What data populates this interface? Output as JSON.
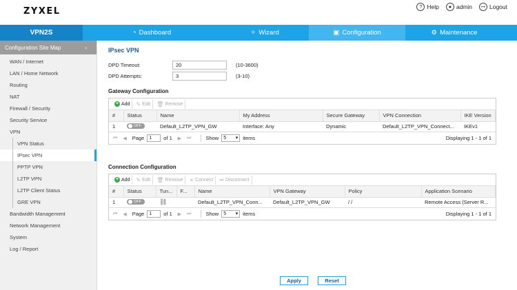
{
  "header": {
    "logo": "ZYXEL",
    "help_label": "Help",
    "user_label": "admin",
    "logout_label": "Logout"
  },
  "nav": {
    "brand": "VPN2S",
    "tabs": [
      {
        "label": "Dashboard",
        "icon": "dashboard-icon"
      },
      {
        "label": "Wizard",
        "icon": "wizard-icon"
      },
      {
        "label": "Configuration",
        "icon": "configuration-icon"
      },
      {
        "label": "Maintenance",
        "icon": "gear-icon"
      }
    ]
  },
  "sidebar": {
    "site_map": "Configuration Site Map",
    "items": [
      "WAN / Internet",
      "LAN / Home Network",
      "Routing",
      "NAT",
      "Firewall / Security",
      "Security Service",
      "VPN",
      "VPN Status",
      "IPsec VPN",
      "PPTP VPN",
      "L2TP VPN",
      "L2TP Client Status",
      "GRE VPN",
      "Bandwidth Management",
      "Network Management",
      "System",
      "Log / Report"
    ]
  },
  "main": {
    "title": "IPsec VPN",
    "dpd_timeout_label": "DPD Timeout:",
    "dpd_timeout_value": "20",
    "dpd_timeout_hint": "(10-3600)",
    "dpd_attempts_label": "DPD Attempts:",
    "dpd_attempts_value": "3",
    "dpd_attempts_hint": "(3-10)"
  },
  "gateway": {
    "section_title": "Gateway Configuration",
    "toolbar": {
      "add": "Add",
      "edit": "Edit",
      "remove": "Remove"
    },
    "columns": [
      "#",
      "Status",
      "Name",
      "My Address",
      "Secure Gateway",
      "VPN Connection",
      "IKE Version"
    ],
    "row": {
      "num": "1",
      "status": "OFF",
      "name": "Default_L2TP_VPN_GW",
      "my_address": "Interface: Any",
      "secure_gateway": "Dynamic",
      "vpn_connection": "Default_L2TP_VPN_Connect...",
      "ike_version": "IKEv1"
    },
    "pager": {
      "page_label": "Page",
      "page_value": "1",
      "of_label": "of 1",
      "show_label": "Show",
      "show_value": "5",
      "items_label": "items",
      "display": "Displaying 1 - 1 of 1"
    }
  },
  "connection": {
    "section_title": "Connection Configuration",
    "toolbar": {
      "add": "Add",
      "edit": "Edit",
      "remove": "Remove",
      "connect": "Connect",
      "disconnect": "Disconnect"
    },
    "columns": [
      "#",
      "Status",
      "Tun...",
      "F...",
      "Name",
      "VPN Gateway",
      "Policy",
      "Application Scenario"
    ],
    "row": {
      "num": "1",
      "status": "OFF",
      "tunnel_icon": "tunnel-icon",
      "f": "",
      "name": "Default_L2TP_VPN_Conn...",
      "vpn_gateway": "Default_L2TP_VPN_GW",
      "policy": "/ /",
      "scenario": "Remote Access (Server R..."
    },
    "pager": {
      "page_label": "Page",
      "page_value": "1",
      "of_label": "of 1",
      "show_label": "Show",
      "show_value": "5",
      "items_label": "items",
      "display": "Displaying 1 - 1 of 1"
    }
  },
  "footer": {
    "apply": "Apply",
    "reset": "Reset"
  },
  "colors": {
    "accent": "#1da3e8",
    "brand": "#1583c8",
    "active_tab": "#43b5ef",
    "title": "#1a5a9c"
  }
}
